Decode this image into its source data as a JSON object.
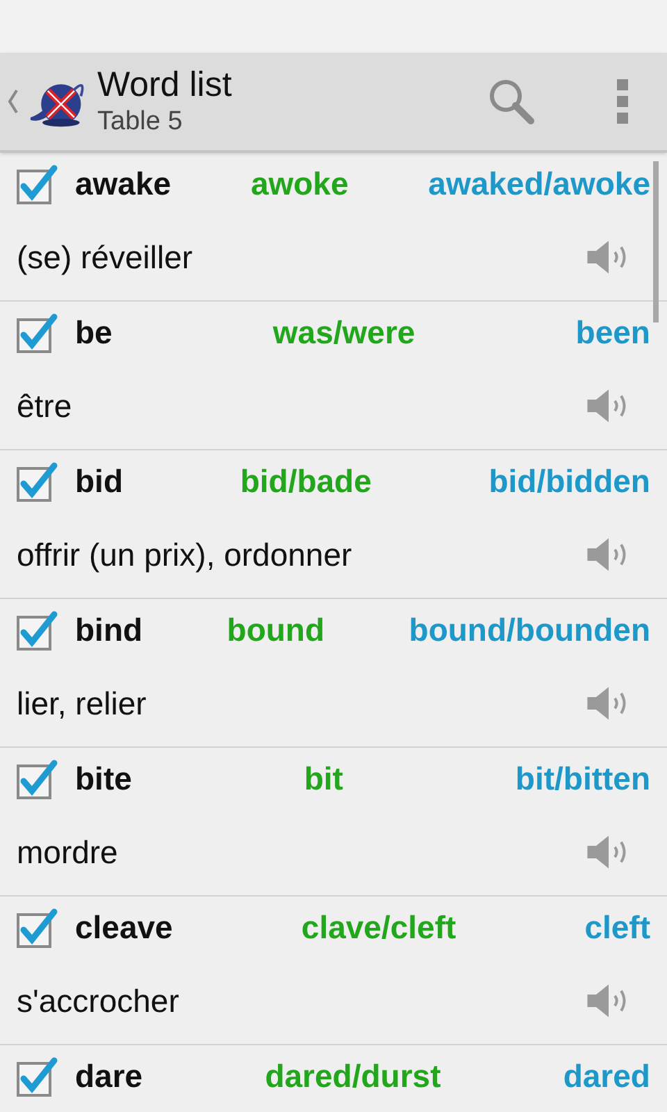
{
  "header": {
    "title": "Word list",
    "subtitle": "Table 5"
  },
  "rows": [
    {
      "checked": true,
      "base": "awake",
      "past": "awoke",
      "participle": "awaked/awoke",
      "translation": "(se) réveiller"
    },
    {
      "checked": true,
      "base": "be",
      "past": "was/were",
      "participle": "been",
      "translation": "être"
    },
    {
      "checked": true,
      "base": "bid",
      "past": "bid/bade",
      "participle": "bid/bidden",
      "translation": "offrir (un prix), ordonner"
    },
    {
      "checked": true,
      "base": "bind",
      "past": "bound",
      "participle": "bound/bounden",
      "translation": "lier, relier"
    },
    {
      "checked": true,
      "base": "bite",
      "past": "bit",
      "participle": "bit/bitten",
      "translation": "mordre"
    },
    {
      "checked": true,
      "base": "cleave",
      "past": "clave/cleft",
      "participle": "cleft",
      "translation": "s'accrocher"
    },
    {
      "checked": true,
      "base": "dare",
      "past": "dared/durst",
      "participle": "dared"
    }
  ]
}
